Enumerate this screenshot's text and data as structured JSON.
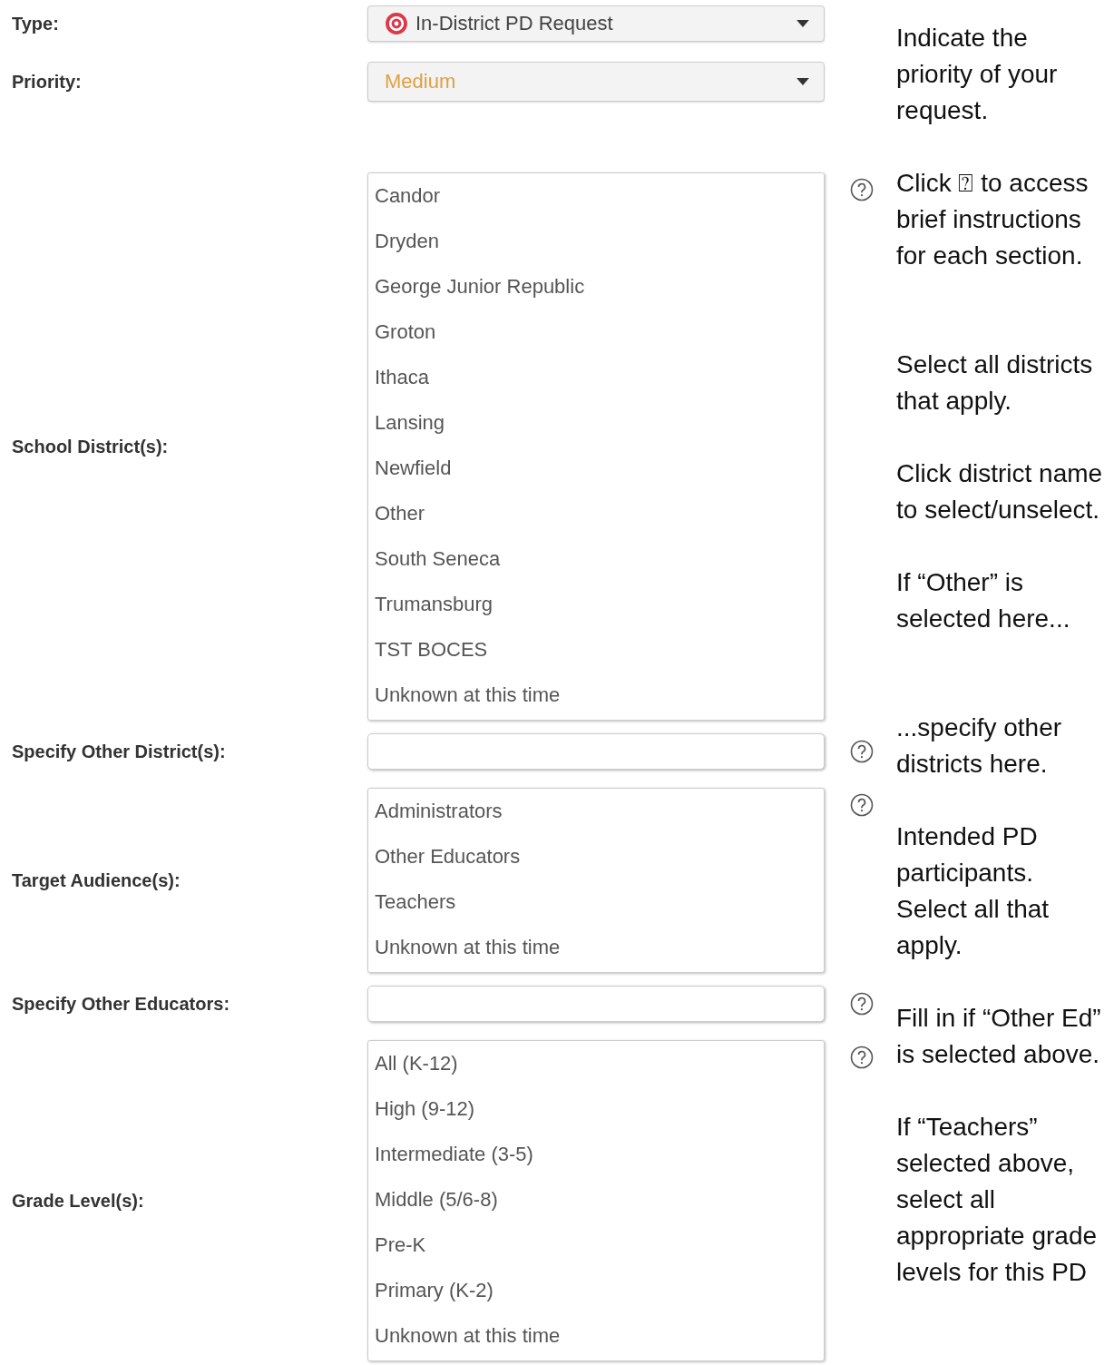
{
  "form": [
    {
      "kind": "select",
      "label": "Type:",
      "value": "In-District PD Request",
      "icon": true,
      "color": "#444444",
      "help": false
    },
    {
      "kind": "select",
      "label": "Priority:",
      "value": "Medium",
      "icon": false,
      "color": "#e0a040",
      "help": false
    },
    {
      "kind": "listbox",
      "label": "School District(s):",
      "help": true,
      "options": [
        {
          "label": "Candor",
          "selected": false
        },
        {
          "label": "Dryden",
          "selected": false
        },
        {
          "label": "George Junior Republic",
          "selected": false
        },
        {
          "label": "Groton",
          "selected": false
        },
        {
          "label": "Ithaca",
          "selected": false
        },
        {
          "label": "Lansing",
          "selected": false
        },
        {
          "label": "Newfield",
          "selected": false
        },
        {
          "label": "Other",
          "selected": false
        },
        {
          "label": "South Seneca",
          "selected": false
        },
        {
          "label": "Trumansburg",
          "selected": false
        },
        {
          "label": "TST BOCES",
          "selected": false
        },
        {
          "label": "Unknown at this time",
          "selected": false
        }
      ]
    },
    {
      "kind": "text",
      "label": "Specify Other District(s):",
      "help": true
    },
    {
      "kind": "listbox",
      "label": "Target Audience(s):",
      "help": true,
      "options": [
        {
          "label": "Administrators",
          "selected": false
        },
        {
          "label": "Other Educators",
          "selected": false
        },
        {
          "label": "Teachers",
          "selected": false
        },
        {
          "label": "Unknown at this time",
          "selected": false
        }
      ]
    },
    {
      "kind": "text",
      "label": "Specify Other Educators:",
      "help": true
    },
    {
      "kind": "listbox",
      "label": "Grade Level(s):",
      "help": true,
      "options": [
        {
          "label": "All (K-12)",
          "selected": false
        },
        {
          "label": "High (9-12)",
          "selected": false
        },
        {
          "label": "Intermediate (3-5)",
          "selected": false
        },
        {
          "label": "Middle (5/6-8)",
          "selected": false
        },
        {
          "label": "Pre-K",
          "selected": false
        },
        {
          "label": "Primary (K-2)",
          "selected": false
        },
        {
          "label": "Unknown at this time",
          "selected": false
        }
      ]
    }
  ],
  "notes": [
    "Indicate the priority of your request.",
    "Click ⍰ to access brief instructions for each section.",
    "Select all districts that apply.",
    "Click district name to select/unselect.",
    "If “Other” is selected here...",
    "...specify other districts here.",
    "Intended PD participants. Select all that apply.",
    "Fill in if “Other Ed” is selected above.",
    "If “Teachers” selected above, select all appropriate grade levels for this PD"
  ]
}
